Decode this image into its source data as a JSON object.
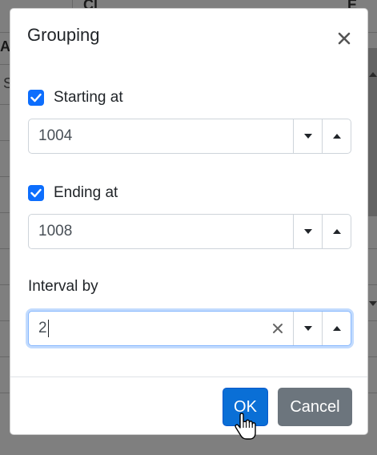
{
  "dialog": {
    "title": "Grouping",
    "starting_at": {
      "label": "Starting at",
      "checked": true,
      "value": "1004"
    },
    "ending_at": {
      "label": "Ending at",
      "checked": true,
      "value": "1008"
    },
    "interval_by": {
      "label": "Interval by",
      "value": "2"
    },
    "ok_label": "OK",
    "cancel_label": "Cancel"
  },
  "background": {
    "partial_texts": [
      "Cl",
      "E",
      "A",
      "S"
    ]
  },
  "colors": {
    "primary": "#0d6efd",
    "secondary": "#6c757d",
    "focus_ring": "#86b7fe"
  }
}
